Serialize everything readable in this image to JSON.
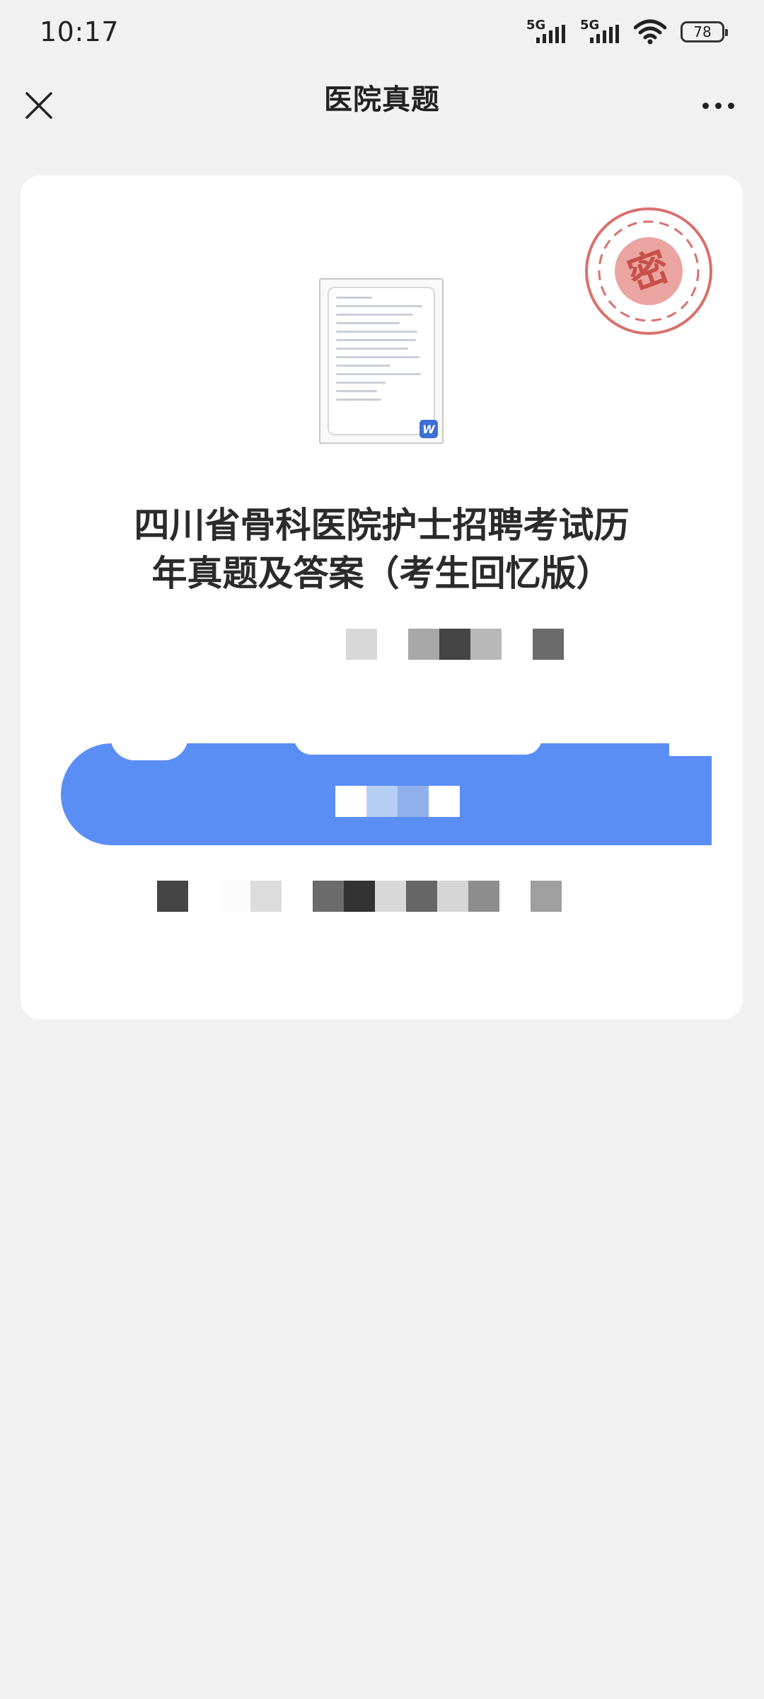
{
  "status_bar": {
    "time": "10:17",
    "signal_1": "5G",
    "signal_2": "5G",
    "battery": "78"
  },
  "nav": {
    "title": "医院真题",
    "close_icon": "close-icon",
    "more_icon": "more-icon"
  },
  "document": {
    "stamp_text": "密",
    "title_line_1": "四川省骨科医院护士招聘考试历",
    "title_line_2": "年真题及答案（考生回忆版）",
    "file_badge": "W"
  },
  "colors": {
    "accent": "#5b8ef5",
    "stamp": "#d9706b",
    "background": "#f1f1f1"
  }
}
